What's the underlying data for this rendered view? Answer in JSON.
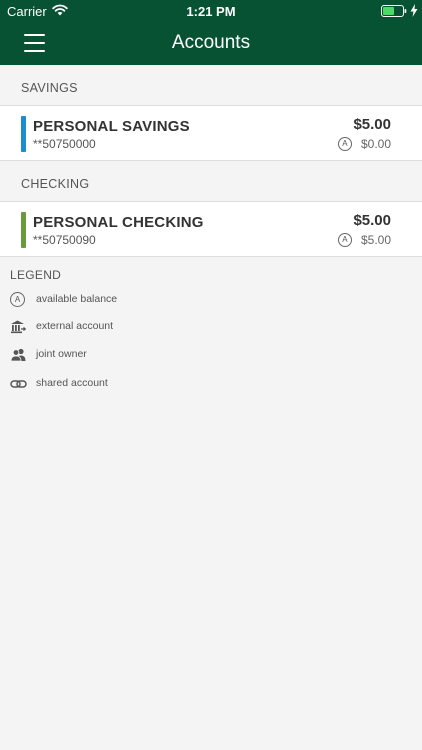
{
  "status_bar": {
    "carrier": "Carrier",
    "time": "1:21 PM"
  },
  "nav": {
    "title": "Accounts"
  },
  "sections": [
    {
      "label": "SAVINGS",
      "accounts": [
        {
          "name": "PERSONAL SAVINGS",
          "number": "**50750000",
          "balance": "$5.00",
          "available_badge": "A",
          "available": "$0.00",
          "accent_color": "#1a8ccf"
        }
      ]
    },
    {
      "label": "CHECKING",
      "accounts": [
        {
          "name": "PERSONAL CHECKING",
          "number": "**50750090",
          "balance": "$5.00",
          "available_badge": "A",
          "available": "$5.00",
          "accent_color": "#6a9a3a"
        }
      ]
    }
  ],
  "legend": {
    "title": "LEGEND",
    "items": [
      {
        "icon": "available-balance-icon",
        "badge": "A",
        "label": "available balance"
      },
      {
        "icon": "bank-transfer-icon",
        "label": "external account"
      },
      {
        "icon": "people-icon",
        "label": "joint owner"
      },
      {
        "icon": "link-icon",
        "label": "shared account"
      }
    ]
  },
  "colors": {
    "header": "#075232",
    "background": "#f4f4f4",
    "battery": "#4cd964"
  }
}
